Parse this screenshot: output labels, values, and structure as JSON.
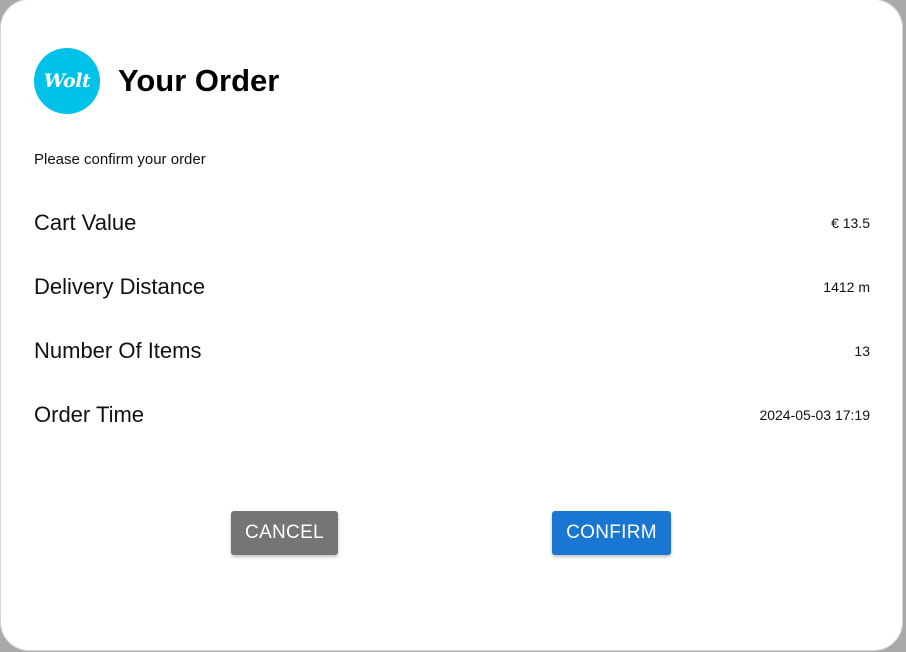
{
  "header": {
    "logo_text": "Wolt",
    "title": "Your Order"
  },
  "subtitle": "Please confirm your order",
  "rows": [
    {
      "label": "Cart Value",
      "value": "€ 13.5"
    },
    {
      "label": "Delivery Distance",
      "value": "1412 m"
    },
    {
      "label": "Number Of Items",
      "value": "13"
    },
    {
      "label": "Order Time",
      "value": "2024-05-03 17:19"
    }
  ],
  "actions": {
    "cancel_label": "CANCEL",
    "confirm_label": "CONFIRM"
  },
  "colors": {
    "brand": "#00c2e8",
    "confirm": "#1976d2",
    "cancel": "#757575"
  }
}
